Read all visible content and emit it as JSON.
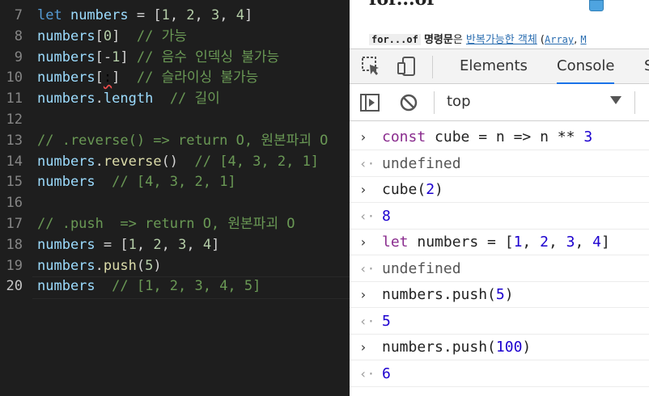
{
  "editor": {
    "lines": [
      {
        "n": "7",
        "tokens": [
          [
            "kw",
            "let "
          ],
          [
            "var",
            "numbers"
          ],
          [
            "op",
            " = ["
          ],
          [
            "num",
            "1"
          ],
          [
            "op",
            ", "
          ],
          [
            "num",
            "2"
          ],
          [
            "op",
            ", "
          ],
          [
            "num",
            "3"
          ],
          [
            "op",
            ", "
          ],
          [
            "num",
            "4"
          ],
          [
            "op",
            "]"
          ]
        ]
      },
      {
        "n": "8",
        "tokens": [
          [
            "var",
            "numbers"
          ],
          [
            "op",
            "["
          ],
          [
            "num",
            "0"
          ],
          [
            "op",
            "]  "
          ],
          [
            "cm",
            "// 가능"
          ]
        ]
      },
      {
        "n": "9",
        "tokens": [
          [
            "var",
            "numbers"
          ],
          [
            "op",
            "["
          ],
          [
            "op",
            "-"
          ],
          [
            "num",
            "1"
          ],
          [
            "op",
            "] "
          ],
          [
            "cm",
            "// 음수 인덱싱 불가능"
          ]
        ]
      },
      {
        "n": "10",
        "tokens": [
          [
            "var",
            "numbers"
          ],
          [
            "op",
            "["
          ],
          [
            "sq",
            ":"
          ],
          [
            "op",
            "]  "
          ],
          [
            "cm",
            "// 슬라이싱 불가능"
          ]
        ]
      },
      {
        "n": "11",
        "tokens": [
          [
            "var",
            "numbers"
          ],
          [
            "op",
            "."
          ],
          [
            "var",
            "length"
          ],
          [
            "op",
            "  "
          ],
          [
            "cm",
            "// 길이"
          ]
        ]
      },
      {
        "n": "12",
        "tokens": []
      },
      {
        "n": "13",
        "tokens": [
          [
            "cm",
            "// .reverse() => return O, 원본파괴 O"
          ]
        ]
      },
      {
        "n": "14",
        "tokens": [
          [
            "var",
            "numbers"
          ],
          [
            "op",
            "."
          ],
          [
            "fn",
            "reverse"
          ],
          [
            "op",
            "()  "
          ],
          [
            "cm",
            "// [4, 3, 2, 1]"
          ]
        ]
      },
      {
        "n": "15",
        "tokens": [
          [
            "var",
            "numbers"
          ],
          [
            "op",
            "  "
          ],
          [
            "cm",
            "// [4, 3, 2, 1]"
          ]
        ]
      },
      {
        "n": "16",
        "tokens": []
      },
      {
        "n": "17",
        "tokens": [
          [
            "cm",
            "// .push  => return O, 원본파괴 O"
          ]
        ]
      },
      {
        "n": "18",
        "tokens": [
          [
            "var",
            "numbers"
          ],
          [
            "op",
            " = ["
          ],
          [
            "num",
            "1"
          ],
          [
            "op",
            ", "
          ],
          [
            "num",
            "2"
          ],
          [
            "op",
            ", "
          ],
          [
            "num",
            "3"
          ],
          [
            "op",
            ", "
          ],
          [
            "num",
            "4"
          ],
          [
            "op",
            "]"
          ]
        ]
      },
      {
        "n": "19",
        "tokens": [
          [
            "var",
            "numbers"
          ],
          [
            "op",
            "."
          ],
          [
            "fn",
            "push"
          ],
          [
            "op",
            "("
          ],
          [
            "num",
            "5"
          ],
          [
            "op",
            ")"
          ]
        ]
      },
      {
        "n": "20",
        "tokens": [
          [
            "var",
            "numbers"
          ],
          [
            "op",
            "  "
          ],
          [
            "cm",
            "// [1, 2, 3, 4, 5]"
          ]
        ]
      }
    ]
  },
  "page": {
    "title": "for...of",
    "text_code": "for...of",
    "text_bold": "명령문",
    "text_mid": "은 ",
    "text_link": "반복가능한 객체",
    "text_paren": " (",
    "text_link2": "Array",
    "text_comma": ", ",
    "text_link3": "M"
  },
  "devtools": {
    "tabs": [
      "Elements",
      "Console",
      "S"
    ],
    "active_tab": "Console",
    "context": "top"
  },
  "console": [
    {
      "type": "input",
      "tokens": [
        [
          "c-kw",
          "const "
        ],
        [
          "",
          "cube "
        ],
        [
          "",
          "= "
        ],
        [
          "",
          "n "
        ],
        [
          "",
          "=> "
        ],
        [
          "",
          "n "
        ],
        [
          "",
          "** "
        ],
        [
          "c-num",
          "3"
        ]
      ]
    },
    {
      "type": "output",
      "tokens": [
        [
          "c-undef",
          "undefined"
        ]
      ]
    },
    {
      "type": "input",
      "tokens": [
        [
          "",
          "cube("
        ],
        [
          "c-num",
          "2"
        ],
        [
          "",
          ")"
        ]
      ]
    },
    {
      "type": "output",
      "tokens": [
        [
          "c-res",
          "8"
        ]
      ]
    },
    {
      "type": "input",
      "tokens": [
        [
          "c-kw",
          "let "
        ],
        [
          "",
          "numbers = ["
        ],
        [
          "c-num",
          "1"
        ],
        [
          "",
          ", "
        ],
        [
          "c-num",
          "2"
        ],
        [
          "",
          ", "
        ],
        [
          "c-num",
          "3"
        ],
        [
          "",
          ", "
        ],
        [
          "c-num",
          "4"
        ],
        [
          "",
          "]"
        ]
      ]
    },
    {
      "type": "output",
      "tokens": [
        [
          "c-undef",
          "undefined"
        ]
      ]
    },
    {
      "type": "input",
      "tokens": [
        [
          "",
          "numbers.push("
        ],
        [
          "c-num",
          "5"
        ],
        [
          "",
          ")"
        ]
      ]
    },
    {
      "type": "output",
      "tokens": [
        [
          "c-res",
          "5"
        ]
      ]
    },
    {
      "type": "input",
      "tokens": [
        [
          "",
          "numbers.push("
        ],
        [
          "c-num",
          "100"
        ],
        [
          "",
          ")"
        ]
      ]
    },
    {
      "type": "output",
      "tokens": [
        [
          "c-res",
          "6"
        ]
      ]
    }
  ],
  "colors": {
    "editor_bg": "#1e1e1e",
    "keyword": "#569cd6",
    "variable": "#9cdcfe",
    "number": "#b5cea8",
    "comment": "#6a9955",
    "function": "#dcdcaa",
    "console_keyword": "#8a2c8e",
    "console_number": "#1c00cf",
    "tab_accent": "#1a73e8"
  }
}
